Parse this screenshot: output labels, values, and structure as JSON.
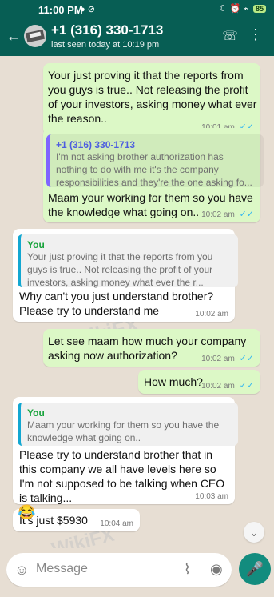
{
  "status": {
    "time": "11:00 PM",
    "left_icons": "● ⊘",
    "right_icons": "☾ ⏰ ⌁",
    "battery": "85"
  },
  "header": {
    "back_icon": "arrow-left",
    "contact_name": "+1 (316) 330-1713",
    "last_seen": "last seen today at 10:19 pm",
    "call_icon": "add-call",
    "menu_icon": "more-vertical"
  },
  "messages": [
    {
      "type": "outgoing",
      "text": "Your just proving it that the reports from you guys is true.. Not releasing the profit of your investors, asking money what ever the reason..",
      "time": "10:01 am",
      "ticks": "✓✓"
    },
    {
      "type": "outgoing-reply",
      "quote_author": "+1 (316) 330-1713",
      "quote_text": "I'm not asking brother authorization has nothing to do with me it's the company responsibilities and they're the one asking fo...",
      "text": "Maam your working for them so you have the knowledge what going on..",
      "time": "10:02 am",
      "ticks": "✓✓"
    },
    {
      "type": "incoming-reply",
      "quote_author": "You",
      "quote_text": "Your just proving it that the reports from you guys is true.. Not releasing the profit of your investors, asking money what ever the r...",
      "text": "Why can't you just understand brother? Please try to understand me",
      "time": "10:02 am"
    },
    {
      "type": "outgoing",
      "text": "Let see maam how much your company asking now authorization?",
      "time": "10:02 am",
      "ticks": "✓✓"
    },
    {
      "type": "outgoing",
      "text": "How much?",
      "time": "10:02 am",
      "ticks": "✓✓"
    },
    {
      "type": "incoming-reply",
      "quote_author": "You",
      "quote_text": "Maam your working for them so you have the knowledge what going on..",
      "text": "Please try to understand brother that in this company we all have levels here so I'm not supposed to be talking when CEO is talking...",
      "time": "10:03 am"
    },
    {
      "type": "incoming",
      "text": "It's just $5930",
      "time": "10:04 am"
    }
  ],
  "emoji_message": "😂",
  "watermark": "WikiFX",
  "composer": {
    "placeholder": "Message",
    "emoji_icon": "smile-icon",
    "attach_icon": "paperclip-icon",
    "camera_icon": "camera-icon",
    "mic_icon": "microphone-icon"
  },
  "colors": {
    "header": "#075e54",
    "outgoing_bubble": "#dcf8c6",
    "incoming_bubble": "#ffffff",
    "mic_button": "#128c7e"
  }
}
